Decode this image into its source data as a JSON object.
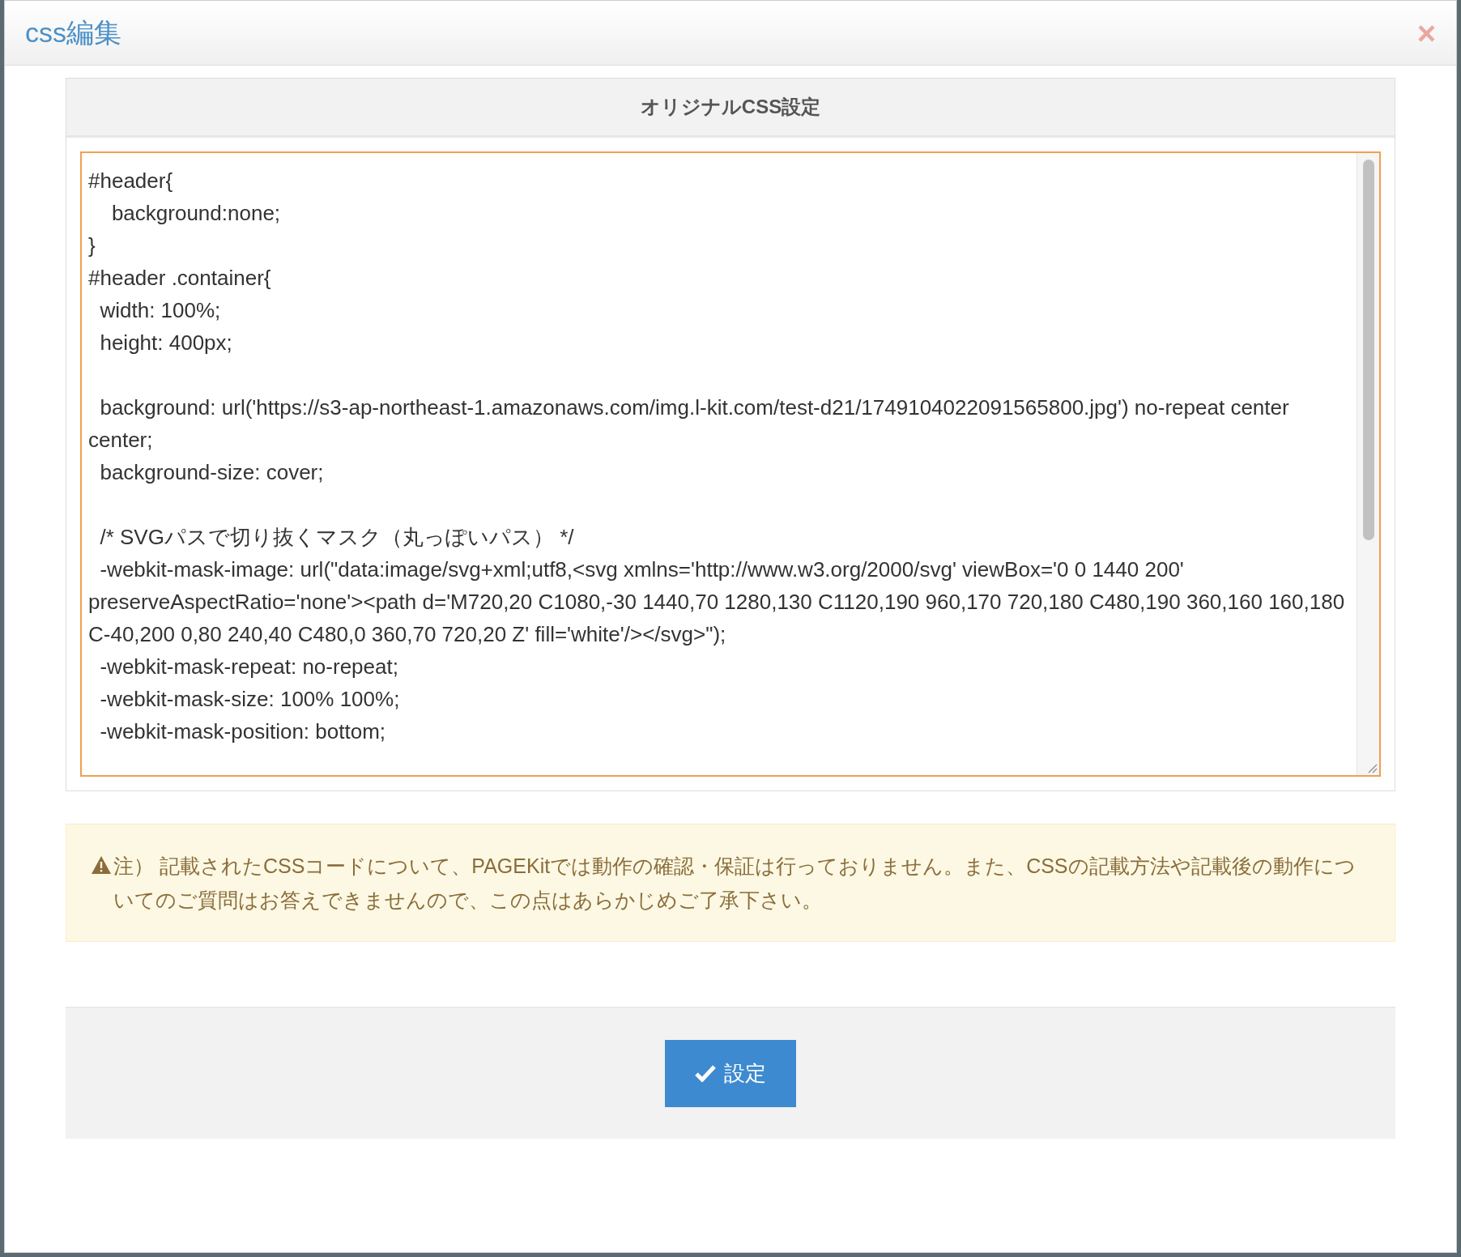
{
  "window": {
    "title": "css編集",
    "close": "×"
  },
  "panel": {
    "title": "オリジナルCSS設定",
    "editor": {
      "focused": true,
      "blocks": [
        [
          "#header{",
          "\tbackground:none;",
          "}",
          "#header .container{",
          "  width: 100%;",
          "  height: 400px;"
        ],
        [
          "  background: url('https://s3-ap-northeast-1.amazonaws.com/img.l-kit.com/test-d21/1749104022091565800.jpg') no-repeat center center;",
          "  background-size: cover;"
        ],
        [
          "  /* SVGパスで切り抜くマスク（丸っぽいパス） */",
          "  -webkit-mask-image: url(\"data:image/svg+xml;utf8,<svg xmlns='http://www.w3.org/2000/svg' viewBox='0 0 1440 200' preserveAspectRatio='none'><path d='M720,20 C1080,-30 1440,70 1280,130 C1120,190 960,170 720,180 C480,190 360,160 160,180 C-40,200 0,80 240,40 C480,0 360,70 720,20 Z' fill='white'/></svg>\");",
          "  -webkit-mask-repeat: no-repeat;",
          "  -webkit-mask-size: 100% 100%;",
          "  -webkit-mask-position: bottom;"
        ]
      ]
    }
  },
  "notice": {
    "text": "注） 記載されたCSSコードについて、PAGEKitでは動作の確認・保証は行っておりません。また、CSSの記載方法や記載後の動作についてのご質問はお答えできませんので、この点はあらかじめご了承下さい。"
  },
  "footer": {
    "button": "設定"
  }
}
